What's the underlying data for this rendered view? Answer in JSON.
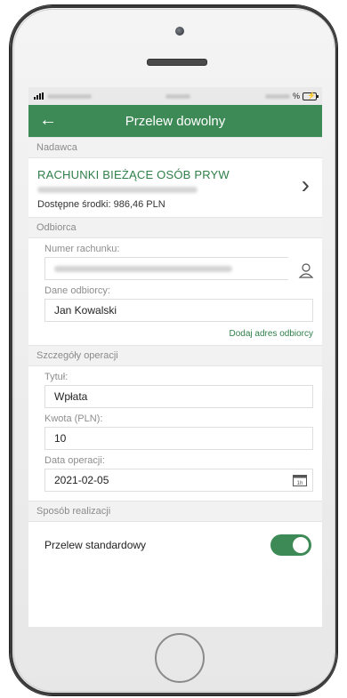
{
  "status_bar": {
    "signal": "signal-icon",
    "battery": "battery-charging-icon",
    "battery_text": "%"
  },
  "app_bar": {
    "title": "Przelew dowolny",
    "back_icon": "arrow-left-icon"
  },
  "sections": {
    "sender": "Nadawca",
    "recipient": "Odbiorca",
    "details": "Szczegóły operacji",
    "execution": "Sposób realizacji"
  },
  "sender": {
    "account_name": "RACHUNKI BIEŻĄCE OSÓB PRYW",
    "balance": "Dostępne środki: 986,46 PLN"
  },
  "recipient": {
    "account_number_label": "Numer rachunku:",
    "recipient_data_label": "Dane odbiorcy:",
    "recipient_name": "Jan Kowalski",
    "add_address_link": "Dodaj adres odbiorcy"
  },
  "details": {
    "title_label": "Tytuł:",
    "title_value": "Wpłata",
    "amount_label": "Kwota (PLN):",
    "amount_value": "10",
    "date_label": "Data operacji:",
    "date_value": "2021-02-05"
  },
  "execution": {
    "standard_label": "Przelew standardowy",
    "standard_enabled": true
  },
  "colors": {
    "brand_green": "#3e8a57",
    "link_green": "#2f7f4a"
  }
}
